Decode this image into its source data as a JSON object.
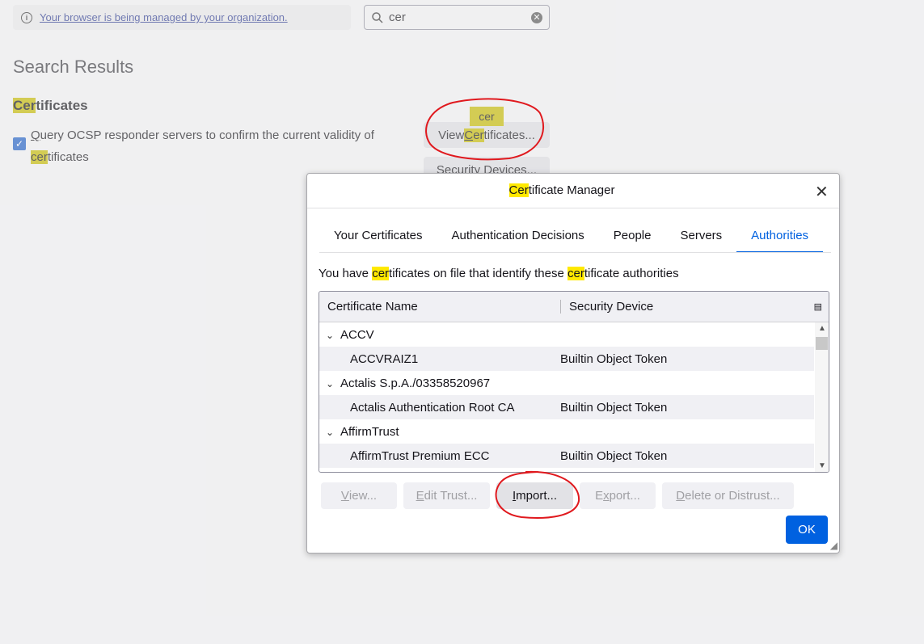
{
  "managed_banner": {
    "text": "Your browser is being managed by your organization."
  },
  "search": {
    "value": "cer"
  },
  "results_title": "Search Results",
  "certificates_section": {
    "heading_hl": "Cer",
    "heading_rest": "tificates",
    "ocsp_line1": "uery OCSP responder servers to confirm the current validity of",
    "ocsp_access_key": "Q",
    "ocsp_hl": "cer",
    "ocsp_rest": "tificates",
    "view_btn_pre": "View ",
    "view_btn_access": "C",
    "view_btn_hl": "er",
    "view_btn_rest": "tificates...",
    "security_devices_btn": "Security Devices...",
    "tooltip": "cer"
  },
  "dialog": {
    "title_hl": "Cer",
    "title_rest": "tificate Manager",
    "close": "✕",
    "tabs": [
      "Your Certificates",
      "Authentication Decisions",
      "People",
      "Servers",
      "Authorities"
    ],
    "description": {
      "p1": "You have ",
      "hl1": "cer",
      "p2": "tificates on file that identify these ",
      "hl2": "cer",
      "p3": "tificate authorities"
    },
    "columns": [
      "Certificate Name",
      "Security Device"
    ],
    "rows": [
      {
        "name": "ACCV",
        "device": ""
      },
      {
        "name": "ACCVRAIZ1",
        "device": "Builtin Object Token"
      },
      {
        "name": "Actalis S.p.A./03358520967",
        "device": ""
      },
      {
        "name": "Actalis Authentication Root CA",
        "device": "Builtin Object Token"
      },
      {
        "name": "AffirmTrust",
        "device": ""
      },
      {
        "name": "AffirmTrust Premium ECC",
        "device": "Builtin Object Token"
      }
    ],
    "buttons": {
      "view_a": "V",
      "view_r": "iew...",
      "edit_a": "E",
      "edit_r": "dit Trust...",
      "import_a": "I",
      "import_r": "mport...",
      "export_a": "x",
      "export_p": "E",
      "export_r": "port...",
      "delete_a": "D",
      "delete_r": "elete or Distrust..."
    },
    "ok": "OK"
  },
  "colors": {
    "accent": "#0061e0",
    "highlight": "#ffe900",
    "annotation": "#e0191e"
  }
}
